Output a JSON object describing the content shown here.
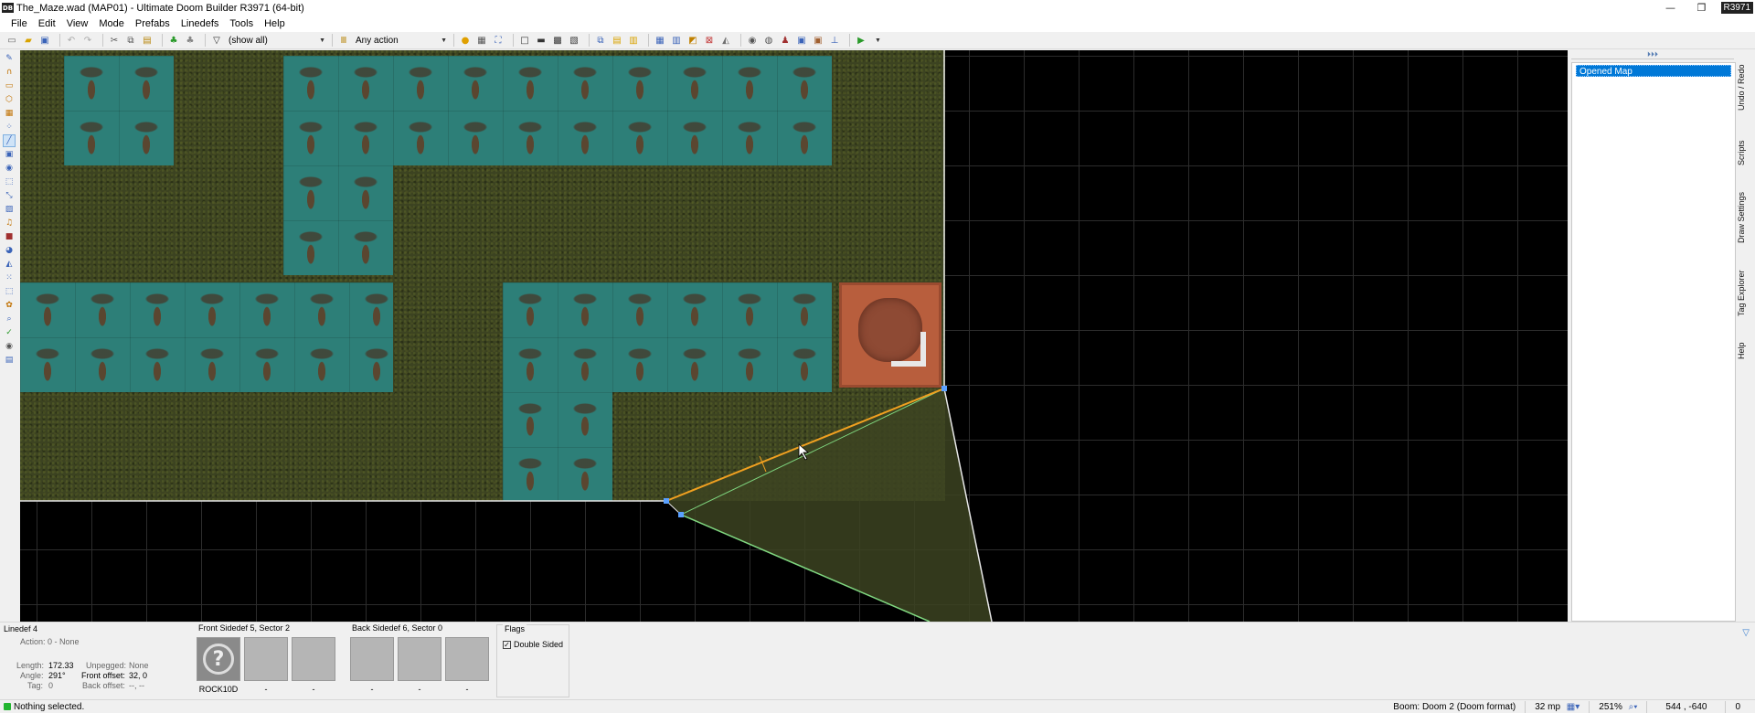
{
  "window": {
    "title": "The_Maze.wad (MAP01) - Ultimate Doom Builder R3971 (64-bit)",
    "icon_text": "DB",
    "revision_badge": "R3971",
    "controls": {
      "minimize": "—",
      "restore": "❐",
      "close": "✕"
    }
  },
  "menu": {
    "items": [
      "File",
      "Edit",
      "View",
      "Mode",
      "Prefabs",
      "Linedefs",
      "Tools",
      "Help"
    ]
  },
  "toolbar": {
    "filter_value": "(show all)",
    "action_value": "Any action"
  },
  "docker": {
    "collapse_glyph": "⏵⏵⏵",
    "history_items": [
      "Opened Map"
    ],
    "side_tabs": [
      "Undo / Redo",
      "Scripts",
      "Draw Settings",
      "Tag Explorer",
      "Help"
    ]
  },
  "info": {
    "linedef_title": "Linedef 4",
    "action": "Action:  0 - None",
    "length_label": "Length:",
    "length_value": "172.33",
    "angle_label": "Angle:",
    "angle_value": "291°",
    "tag_label": "Tag:",
    "tag_value": "0",
    "unpegged_label": "Unpegged:",
    "unpegged_value": "None",
    "front_offset_label": "Front offset:",
    "front_offset_value": "32, 0",
    "back_offset_label": "Back offset:",
    "back_offset_value": "--, --",
    "front_sidedef_title": "Front Sidedef 5, Sector 2",
    "front_textures": [
      "ROCK10D",
      "-",
      "-"
    ],
    "back_sidedef_title": "Back Sidedef 6, Sector 0",
    "back_textures": [
      "-",
      "-",
      "-"
    ],
    "flags_title": "Flags",
    "flag_double_sided": "Double Sided"
  },
  "status": {
    "message": "Nothing selected.",
    "game_config": "Boom: Doom 2 (Doom format)",
    "grid_size": "32 mp",
    "zoom": "251%",
    "coordinates": "544 , -640",
    "counter": "0"
  }
}
